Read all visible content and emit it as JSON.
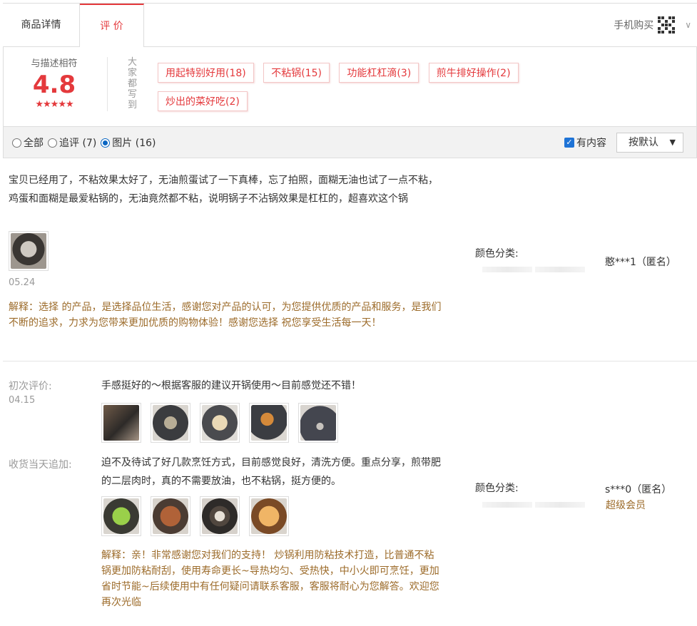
{
  "tabs": [
    {
      "label": "商品详情"
    },
    {
      "label": "评 价"
    }
  ],
  "mobile_buy": "手机购买",
  "summary": {
    "label": "与描述相符",
    "score": "4.8",
    "stars": "★★★★★",
    "everyone_says": "大家都写到",
    "tags": [
      "用起特别好用(18)",
      "不粘锅(15)",
      "功能杠杠滴(3)",
      "煎牛排好操作(2)",
      "炒出的菜好吃(2)"
    ]
  },
  "filter": {
    "options": [
      {
        "label": "全部",
        "selected": false
      },
      {
        "label": "追评 (7)",
        "selected": false
      },
      {
        "label": "图片 (16)",
        "selected": true
      }
    ],
    "has_content": "有内容",
    "sort": "按默认"
  },
  "reviews": [
    {
      "text": "宝贝已经用了，不粘效果太好了，无油煎蛋试了一下真棒，忘了拍照，面糊无油也试了一点不粘，鸡蛋和面糊是最爱粘锅的，无油竟然都不粘，说明锅子不沾锅效果是杠杠的，超喜欢这个锅",
      "date": "05.24",
      "reply_label": "解释：",
      "reply": "选择 的产品，是选择品位生活，感谢您对产品的认可，为您提供优质的产品和服务，是我们不断的追求，力求为您带来更加优质的购物体验！感谢您选择 祝您享受生活每一天！",
      "color_label": "颜色分类:",
      "user": "憨***1（匿名）"
    },
    {
      "initial_label": "初次评价:",
      "date": "04.15",
      "text": "手感挺好的～根据客服的建议开锅使用～目前感觉还不错！",
      "followup_label": "收货当天追加:",
      "followup": "迫不及待试了好几款烹饪方式，目前感觉良好，清洗方便。重点分享，煎带肥的二层肉时，真的不需要放油，也不粘锅，挺方便的。",
      "reply_label": "解释：",
      "reply": "亲！非常感谢您对我们的支持！ 炒锅利用防粘技术打造，比普通不粘锅更加防粘耐刮，使用寿命更长~导热均匀、受热快，中小火即可烹饪，更加省时节能~后续使用中有任何疑问请联系客服，客服将耐心为您解答。欢迎您再次光临",
      "color_label": "颜色分类:",
      "user": "s***0（匿名）",
      "vip": "超级会员"
    }
  ]
}
